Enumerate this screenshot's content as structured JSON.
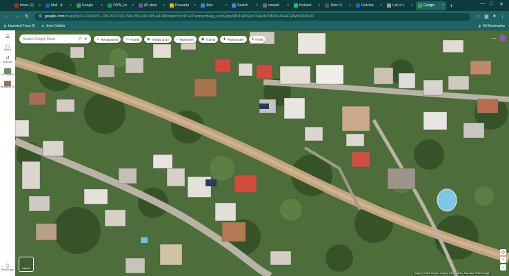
{
  "tabs": [
    {
      "label": "Inbox (2)",
      "color": "#c5221f"
    },
    {
      "label": "Mail - A",
      "color": "#0a66c2"
    },
    {
      "label": "Google",
      "color": "#34a853"
    },
    {
      "label": "OSW_co",
      "color": "#0f9d58"
    },
    {
      "label": "(8) stren",
      "color": "#8e44ad"
    },
    {
      "label": "Presenta",
      "color": "#f4b400"
    },
    {
      "label": "Alris",
      "color": "#1e88e5"
    },
    {
      "label": "Search",
      "color": "#4285f4"
    },
    {
      "label": "oswald",
      "color": "#6d6d6d"
    },
    {
      "label": "Kickstar",
      "color": "#05ce78"
    },
    {
      "label": "John Cr",
      "color": "#555555"
    },
    {
      "label": "Fletcher",
      "color": "#1565c0"
    },
    {
      "label": "List of L",
      "color": "#999999"
    },
    {
      "label": "Google",
      "color": "#34a853",
      "active": true
    }
  ],
  "newtab_glyph": "+",
  "address": {
    "host": "google.com",
    "rest": "/maps/@34.1026488,-118.2522399,150a,35y,240.68h,44.98t/data=!3m1!1e3?entry=ttu&g_ep=EgoyMDI1MDQwOS4wIKXMDSoASAFQAw%3D%3D"
  },
  "bookmarks": {
    "items": [
      "Imported From IE",
      "John Cellalu"
    ],
    "all": "All Bookmarks"
  },
  "rail": [
    {
      "label": "",
      "icon": "menu-icon"
    },
    {
      "label": "Saved",
      "icon": "bookmark-icon"
    },
    {
      "label": "Recents",
      "icon": "history-icon"
    },
    {
      "label": "Los Angeles",
      "icon": "thumb"
    },
    {
      "label": "Redlands Fe",
      "icon": "thumb"
    },
    {
      "label": "Get the app",
      "icon": "phone-icon"
    }
  ],
  "search": {
    "placeholder": "Search Google Maps"
  },
  "chips": [
    {
      "label": "Restaurants",
      "icon": "fork-icon"
    },
    {
      "label": "Hotels",
      "icon": "bed-icon"
    },
    {
      "label": "Things to do",
      "icon": "camera-icon"
    },
    {
      "label": "Museums",
      "icon": "museum-icon"
    },
    {
      "label": "Transit",
      "icon": "bus-icon"
    },
    {
      "label": "Pharmacies",
      "icon": "pill-icon"
    },
    {
      "label": "ATMs",
      "icon": "atm-icon"
    }
  ],
  "layers_label": "Layers",
  "attribution": "Imagery ©2025 Google, Imagery ©2025 Airbus, Map data ©2025 Google",
  "colors": {
    "chrome": "#0d3b3b",
    "toolbar": "#1f6363",
    "vegetation": "#4d6e3a",
    "street": "#b9b3a6",
    "dirt_path": "#c2a37f"
  }
}
